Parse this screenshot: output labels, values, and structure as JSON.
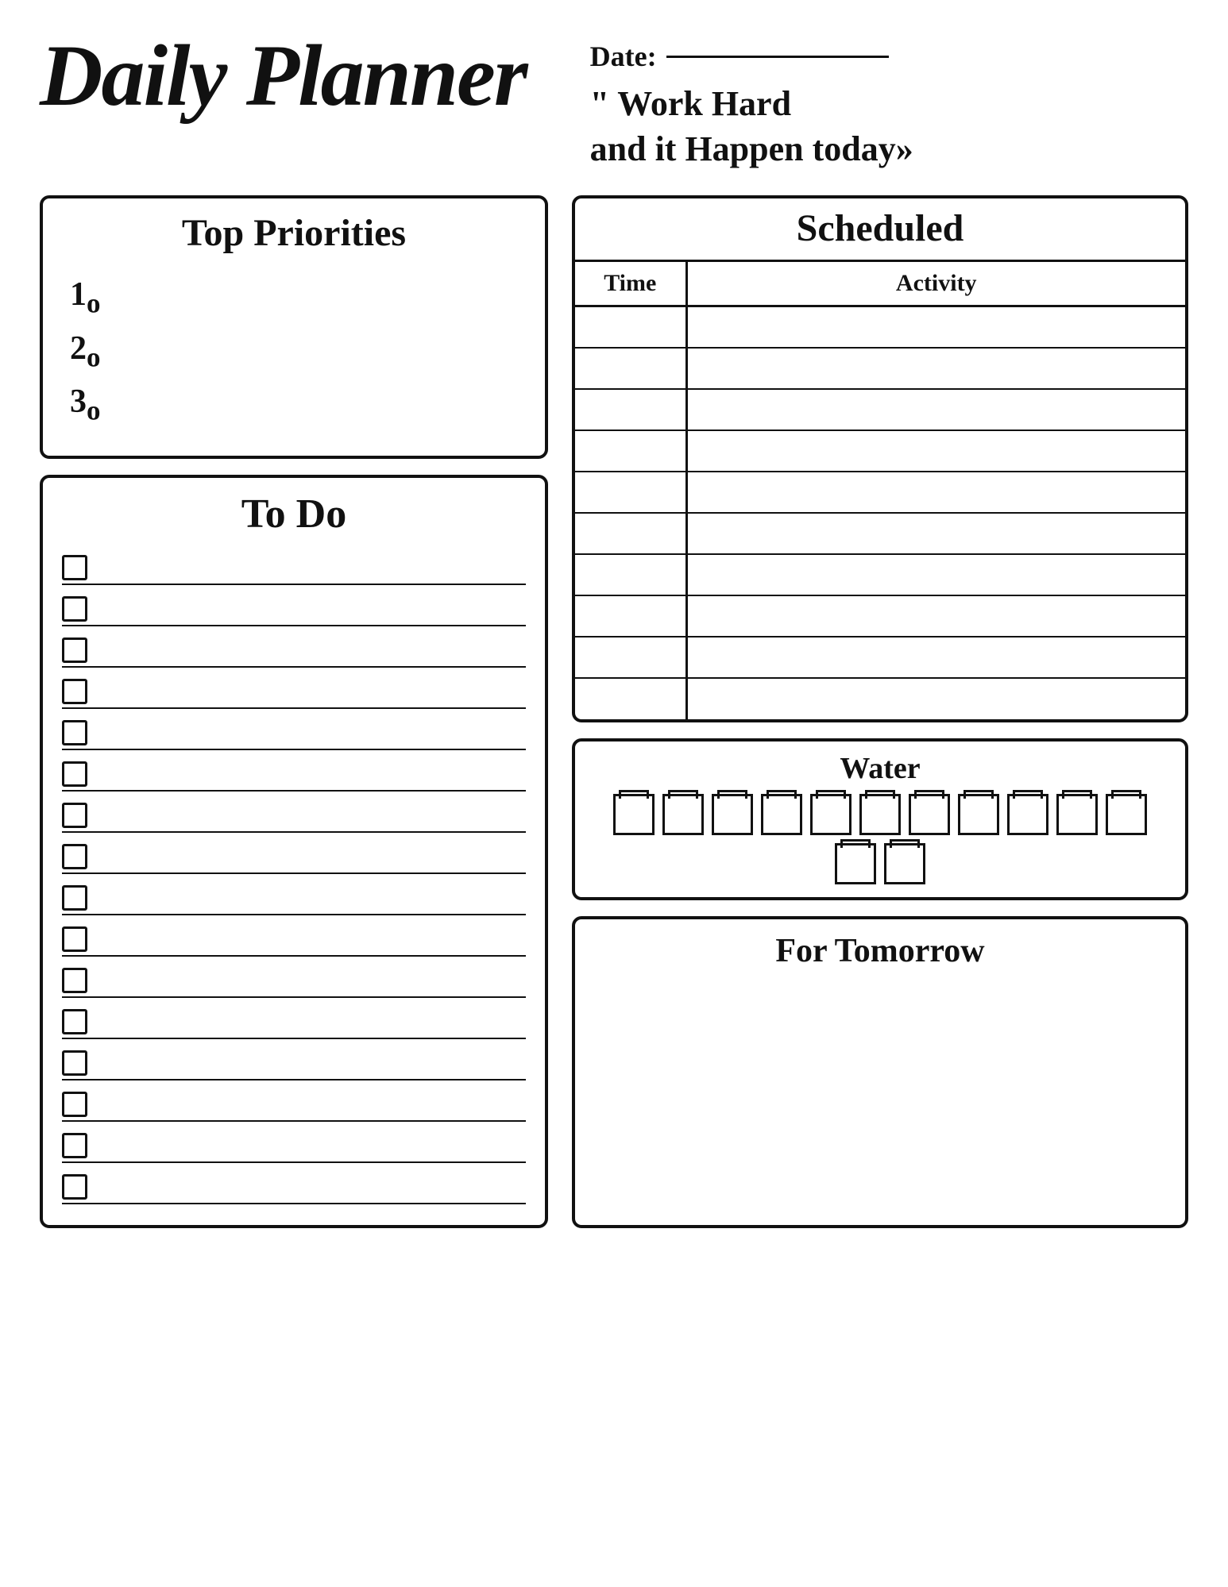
{
  "header": {
    "title": "Daily Planner",
    "date_label": "Date:",
    "quote": "\" Work Hard\nand it Happen today»"
  },
  "priorities": {
    "title": "Top Priorities",
    "items": [
      "1•",
      "2•",
      "3•"
    ]
  },
  "todo": {
    "title": "To Do",
    "count": 16
  },
  "scheduled": {
    "title": "Scheduled",
    "col_time": "Time",
    "col_activity": "Activity",
    "rows": 10
  },
  "water": {
    "title": "Water",
    "cups": 13
  },
  "tomorrow": {
    "title": "For Tomorrow"
  }
}
